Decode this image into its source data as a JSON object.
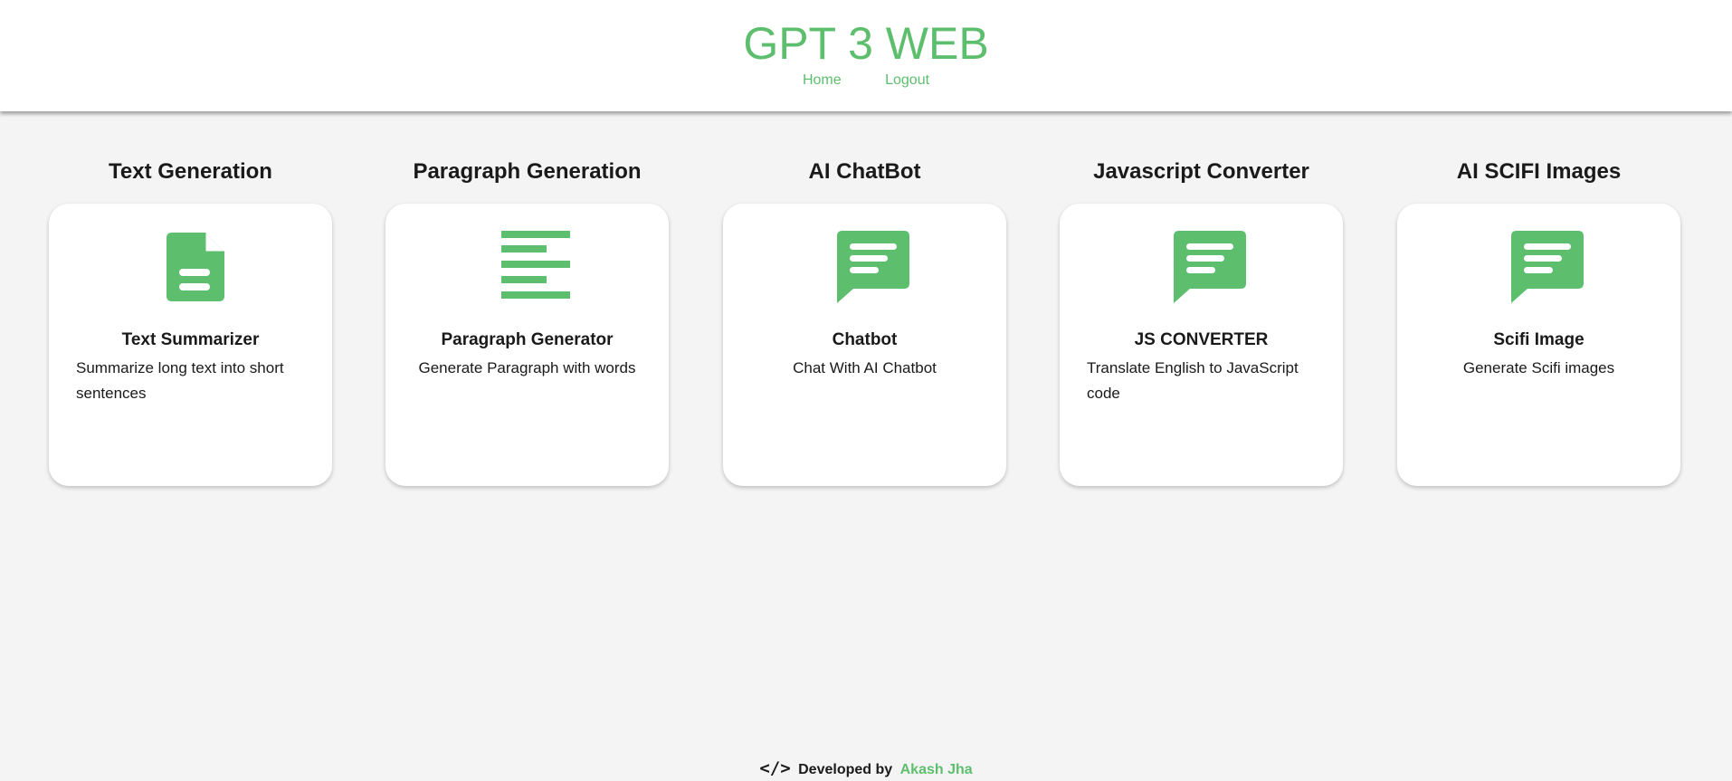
{
  "header": {
    "brand": "GPT 3 WEB",
    "nav": [
      "Home",
      "Logout"
    ]
  },
  "accent_color": "#5dbf6e",
  "columns": [
    {
      "section_title": "Text Generation",
      "card_title": "Text Summarizer",
      "card_desc": "Summarize long text into short sentences",
      "icon": "document-icon"
    },
    {
      "section_title": "Paragraph Generation",
      "card_title": "Paragraph Generator",
      "card_desc": "Generate Paragraph with words",
      "icon": "align-left-icon"
    },
    {
      "section_title": "AI ChatBot",
      "card_title": "Chatbot",
      "card_desc": "Chat With AI Chatbot",
      "icon": "chat-bubble-icon"
    },
    {
      "section_title": "Javascript Converter",
      "card_title": "JS CONVERTER",
      "card_desc": "Translate English to JavaScript code",
      "icon": "chat-bubble-icon"
    },
    {
      "section_title": "AI SCIFI Images",
      "card_title": "Scifi Image",
      "card_desc": "Generate Scifi images",
      "icon": "chat-bubble-icon"
    }
  ],
  "footer": {
    "code_icon": "</>",
    "developed_by": "Developed by",
    "author": "Akash Jha"
  }
}
